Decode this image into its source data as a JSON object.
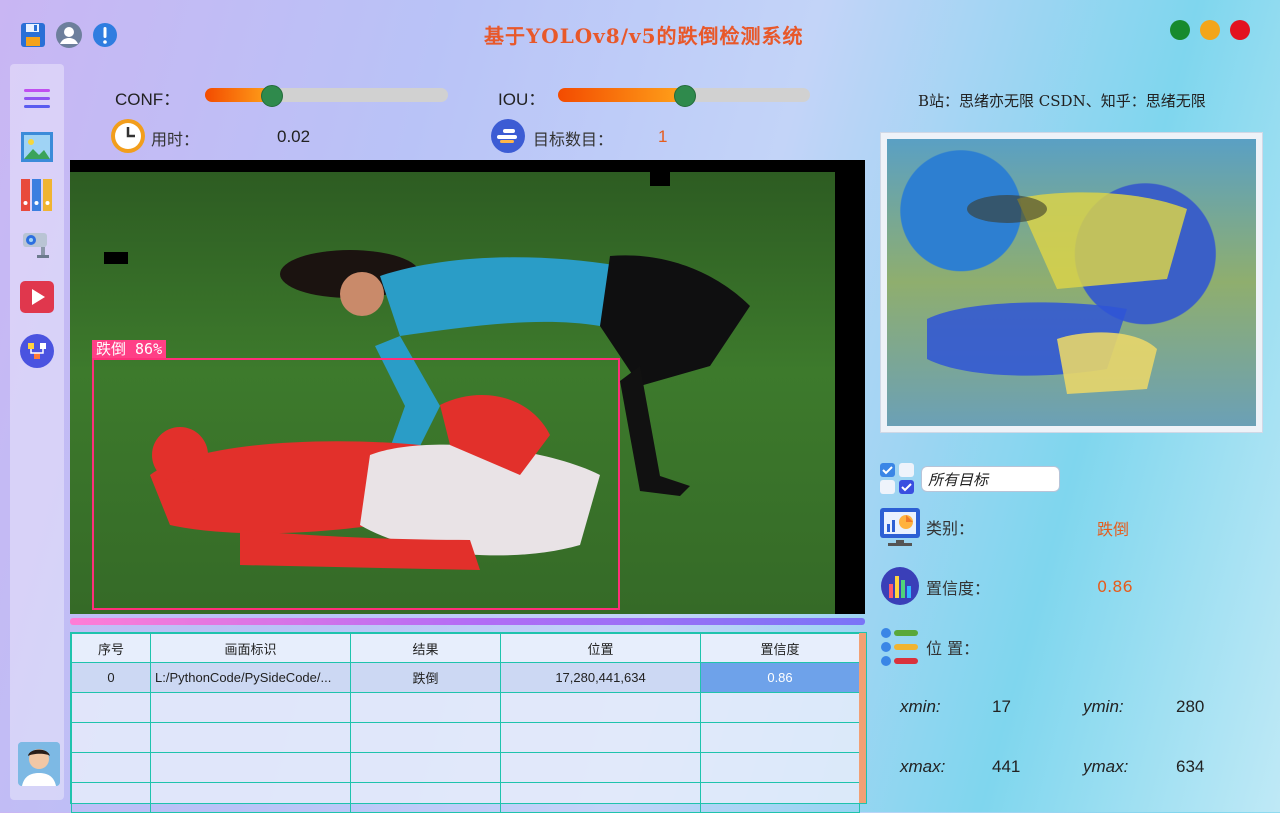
{
  "window": {
    "title": "基于YOLOv8/v5的跌倒检测系统"
  },
  "colors": {
    "accent_orange": "#e8582a",
    "close": "#e3121f",
    "minimize": "#f3a51a",
    "maximize": "#178a2d",
    "table_border": "#1fc3ad",
    "selected_cell": "#6ea2ea"
  },
  "top_icons": [
    "save-icon",
    "user-icon",
    "alert-icon"
  ],
  "sidebar": {
    "items": [
      "menu-icon",
      "image-icon",
      "folder-icon",
      "camera-icon",
      "video-icon",
      "model-icon"
    ]
  },
  "conf": {
    "label": "CONF：",
    "value": 0.27
  },
  "iou": {
    "label": "IOU：",
    "value": 0.5
  },
  "stats": {
    "time_label": "用时：",
    "time_value": "0.02",
    "count_label": "目标数目：",
    "count_value": "1"
  },
  "detection": {
    "tag": "跌倒 86%"
  },
  "table": {
    "headers": [
      "序号",
      "画面标识",
      "结果",
      "位置",
      "置信度"
    ],
    "rows": [
      [
        "0",
        "L:/PythonCode/PySideCode/...",
        "跌倒",
        "17,280,441,634",
        "0.86"
      ],
      [
        "",
        "",
        "",
        "",
        ""
      ],
      [
        "",
        "",
        "",
        "",
        ""
      ],
      [
        "",
        "",
        "",
        "",
        ""
      ],
      [
        "",
        "",
        "",
        "",
        ""
      ]
    ]
  },
  "right": {
    "credit": "B站：思绪亦无限  CSDN、知乎：思绪无限",
    "target_select": "所有目标",
    "class_label": "类别：",
    "class_value": "跌倒",
    "conf_label": "置信度：",
    "conf_value": "0.86",
    "pos_label": "位 置：",
    "xmin_label": "xmin:",
    "xmin_value": "17",
    "ymin_label": "ymin:",
    "ymin_value": "280",
    "xmax_label": "xmax:",
    "xmax_value": "441",
    "ymax_label": "ymax:",
    "ymax_value": "634"
  }
}
